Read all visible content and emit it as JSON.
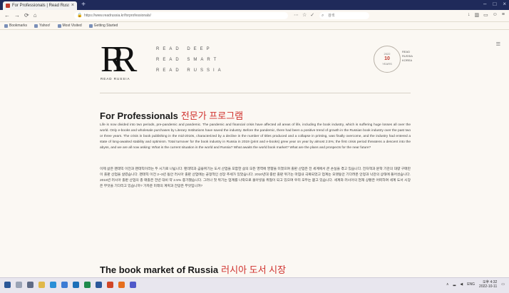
{
  "browser": {
    "tab_title": "For Professionals | Read Russia",
    "tab_close": "×",
    "new_tab": "+",
    "window_controls": [
      "–",
      "□",
      "×"
    ],
    "nav": {
      "back": "←",
      "forward": "→",
      "reload": "⟳",
      "home": "⌂"
    },
    "url": "https://www.readrussia.kr/forprofessionals/",
    "addr_icons": [
      "⋯",
      "☆",
      "✓"
    ],
    "search_placeholder": "검색",
    "right_icons": [
      "↓",
      "▥",
      "▭",
      "☺",
      "≡"
    ],
    "bookmarks": [
      "Bookmarks",
      "Yahoo!",
      "Most Visited",
      "Getting Started"
    ]
  },
  "header": {
    "logo_letters": "RR",
    "logo_sub": "READ RUSSIA",
    "slogans": [
      "READ DEEP",
      "READ SMART",
      "READ RUSSIA"
    ],
    "badge": {
      "top": "2022",
      "middle": "10",
      "bottom": "YEARS",
      "side_lines": [
        "READ",
        "RUSSIA",
        "KOREA"
      ]
    },
    "menu_icon": "≡"
  },
  "sections": [
    {
      "title_en": "For Professionals",
      "title_ko": "전문가 프로그램",
      "paragraphs": [
        "Life is now divided into two periods, pre-pandemic and pandemic. The pandemic and financial crisis have affected all areas of life, including the book industry, which is suffering huge losses all over the world. Only e-books and wholesale purchases by Literary Institutions have saved the industry. Before the pandemic, there had been a positive trend of growth in the Russian book industry over the past two or three years. The crisis in book publishing in the mid-2010s, characterized by a decline in the number of titles produced and a collapse in printing, was finally overcome, and the industry had entered a state of long-awaited stability and optimism. Total turnover for the book industry in Russia in 2019 (print and e-books) grew year on year by almost 2.5%; the first crisis period threatens a descent into the abyss, and we are all now asking: What is the current situation in the world and Russia? What awaits the world book market? What are the plans and prospects for the near future?",
        "이제 삶은 팬데믹 이전과 팬데믹이라는 두 시기로 나뉩니다. 팬데믹과 금융위기는 도서 산업을 포함한 삶의 모든 영역에 영향을 미쳤으며 출판 산업은 전 세계에서 큰 손실을 겪고 있습니다. 전자책과 문학 기관의 대량 구매만이 출판 산업을 살렸습니다. 팬데믹 이전 2~3년 동안 러시아 출판 산업에는 긍정적인 성장 추세가 있었습니다. 2010년대 중반 출판 위기는 마침내 극복되었고 업계는 오랫동안 기다려온 안정과 낙관의 상태에 들어섰습니다. 2019년 러시아 출판 산업의 총 매출은 전년 대비 약 2.5% 증가했습니다. 그러나 첫 위기는 업계를 나락으로 몰아넣을 위협이 되고 있으며 우리 모두는 묻고 있습니다. 세계와 러시아의 현재 상황은 어떠하며 세계 도서 시장은 무엇을 기다리고 있습니까? 가까운 미래의 계획과 전망은 무엇입니까?"
      ]
    },
    {
      "title_en": "The book market of Russia",
      "title_ko": "러시아 도서 시장",
      "paragraphs": []
    }
  ],
  "taskbar": {
    "tray_text": "ENG",
    "time": "오후 4:32",
    "date": "2022-10-11"
  },
  "colors": {
    "accent_red": "#d0312d",
    "tabbar": "#1f2a5a",
    "page_bg": "#fbf8f3",
    "outer_bg": "#f6efe4"
  }
}
